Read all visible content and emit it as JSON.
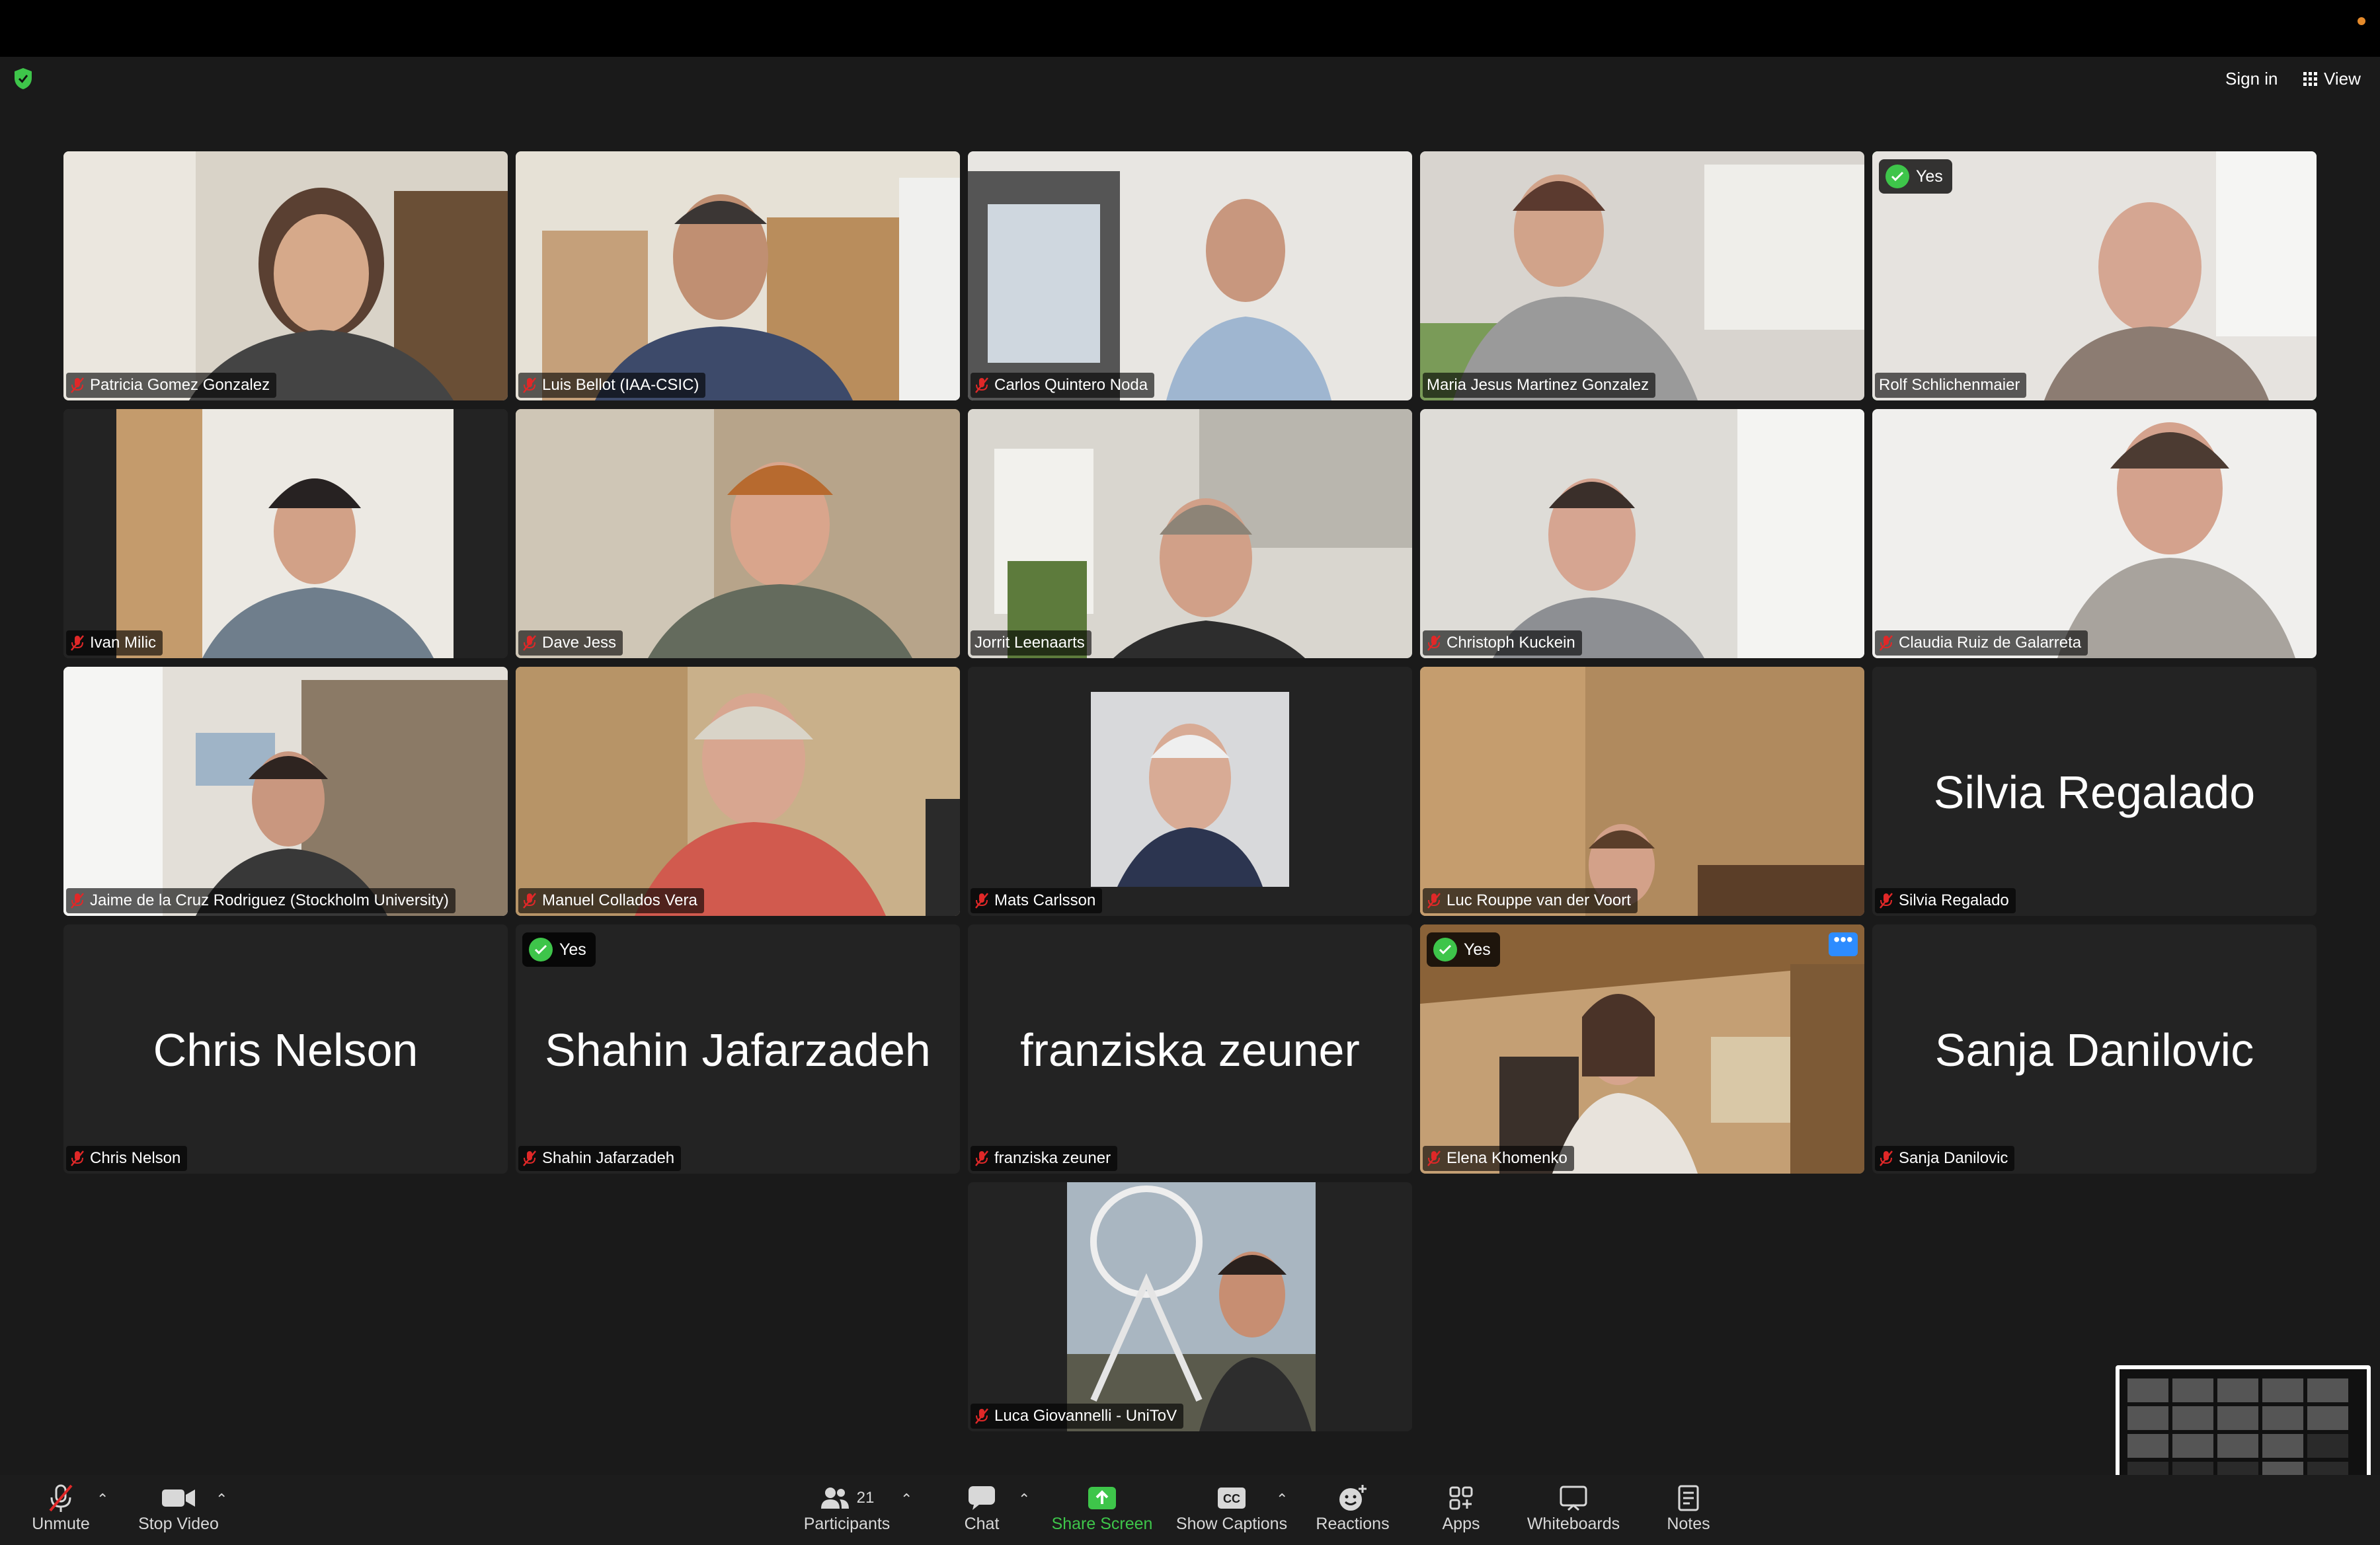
{
  "header": {
    "sign_in": "Sign in",
    "view": "View"
  },
  "participants": [
    {
      "name": "Patricia Gomez Gonzalez",
      "muted": true,
      "video": true
    },
    {
      "name": "Luis Bellot (IAA-CSIC)",
      "muted": true,
      "video": true
    },
    {
      "name": "Carlos Quintero Noda",
      "muted": true,
      "video": true
    },
    {
      "name": "Maria Jesus Martinez Gonzalez",
      "muted": false,
      "video": true
    },
    {
      "name": "Rolf Schlichenmaier",
      "muted": false,
      "video": true,
      "reaction": "Yes",
      "speaking": true
    },
    {
      "name": "Ivan Milic",
      "muted": true,
      "video": true
    },
    {
      "name": "Dave Jess",
      "muted": true,
      "video": true
    },
    {
      "name": "Jorrit Leenaarts",
      "muted": false,
      "video": true
    },
    {
      "name": "Christoph Kuckein",
      "muted": true,
      "video": true
    },
    {
      "name": "Claudia Ruiz de Galarreta",
      "muted": true,
      "video": true
    },
    {
      "name": "Jaime de la Cruz Rodriguez (Stockholm University)",
      "muted": true,
      "video": true
    },
    {
      "name": "Manuel Collados Vera",
      "muted": true,
      "video": true
    },
    {
      "name": "Mats Carlsson",
      "muted": true,
      "video": true
    },
    {
      "name": "Luc Rouppe van der Voort",
      "muted": true,
      "video": true
    },
    {
      "name": "Silvia Regalado",
      "muted": true,
      "video": false
    },
    {
      "name": "Chris Nelson",
      "muted": true,
      "video": false
    },
    {
      "name": "Shahin Jafarzadeh",
      "muted": true,
      "video": false,
      "reaction": "Yes"
    },
    {
      "name": "franziska zeuner",
      "muted": true,
      "video": false
    },
    {
      "name": "Elena Khomenko",
      "muted": true,
      "video": true,
      "reaction": "Yes"
    },
    {
      "name": "Sanja Danilovic",
      "muted": true,
      "video": false
    },
    {
      "name": "Luca Giovannelli - UniToV",
      "muted": true,
      "video": true
    }
  ],
  "toolbar": {
    "unmute": "Unmute",
    "stop_video": "Stop Video",
    "participants": "Participants",
    "participant_count": "21",
    "chat": "Chat",
    "share_screen": "Share Screen",
    "show_captions": "Show Captions",
    "reactions": "Reactions",
    "apps": "Apps",
    "whiteboards": "Whiteboards",
    "notes": "Notes"
  },
  "colors": {
    "accent_green": "#3ec54a",
    "mute_red": "#e02828",
    "more_blue": "#2d8cff"
  }
}
